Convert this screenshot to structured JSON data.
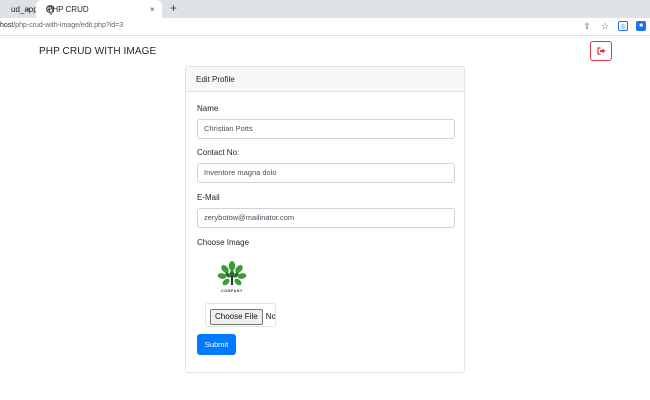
{
  "browser": {
    "tabs": [
      {
        "title": "ud_app |",
        "active": false
      },
      {
        "title": "PHP CRUD",
        "active": true
      }
    ],
    "tab_close_glyph": "×",
    "new_tab_glyph": "+",
    "url_host": "host",
    "url_path": "/php-crud-with-image/edit.php?id=3",
    "toolbar_icons": [
      "share-icon",
      "star-icon",
      "lens-icon",
      "extension-icon"
    ]
  },
  "header": {
    "brand": "PHP CRUD WITH IMAGE",
    "logout_icon": "sign-out-icon",
    "logout_color": "#dc3545"
  },
  "card": {
    "title": "Edit Profile",
    "fields": {
      "name_label": "Name",
      "name_value": "Christian Potts",
      "contact_label": "Contact No:",
      "contact_value": "Inventore magna dolo",
      "email_label": "E-Mail",
      "email_value": "zerybotow@mailinator.com",
      "image_label": "Choose Image"
    },
    "image_caption": "COMPANY",
    "file_button": "Choose File",
    "file_status": "No",
    "submit_label": "Submit",
    "accent_color": "#007bff"
  }
}
